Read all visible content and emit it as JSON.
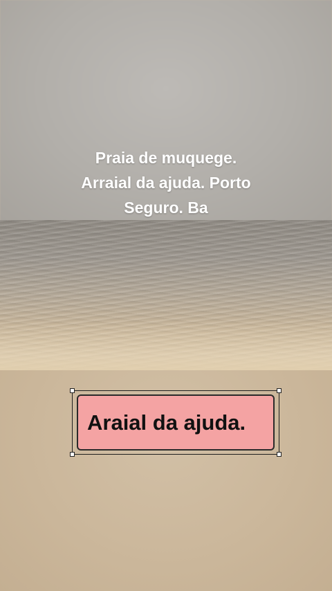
{
  "video": {
    "caption_lines": [
      "Praia de muquege.",
      "Arraial da ajuda. Porto",
      "Seguro. Ba"
    ],
    "sticker": {
      "text": "Araial da ajuda.",
      "background": "#f4a3a3",
      "selected": true
    }
  },
  "colors": {
    "caption_text": "#ffffff",
    "sticker_text": "#111111"
  }
}
